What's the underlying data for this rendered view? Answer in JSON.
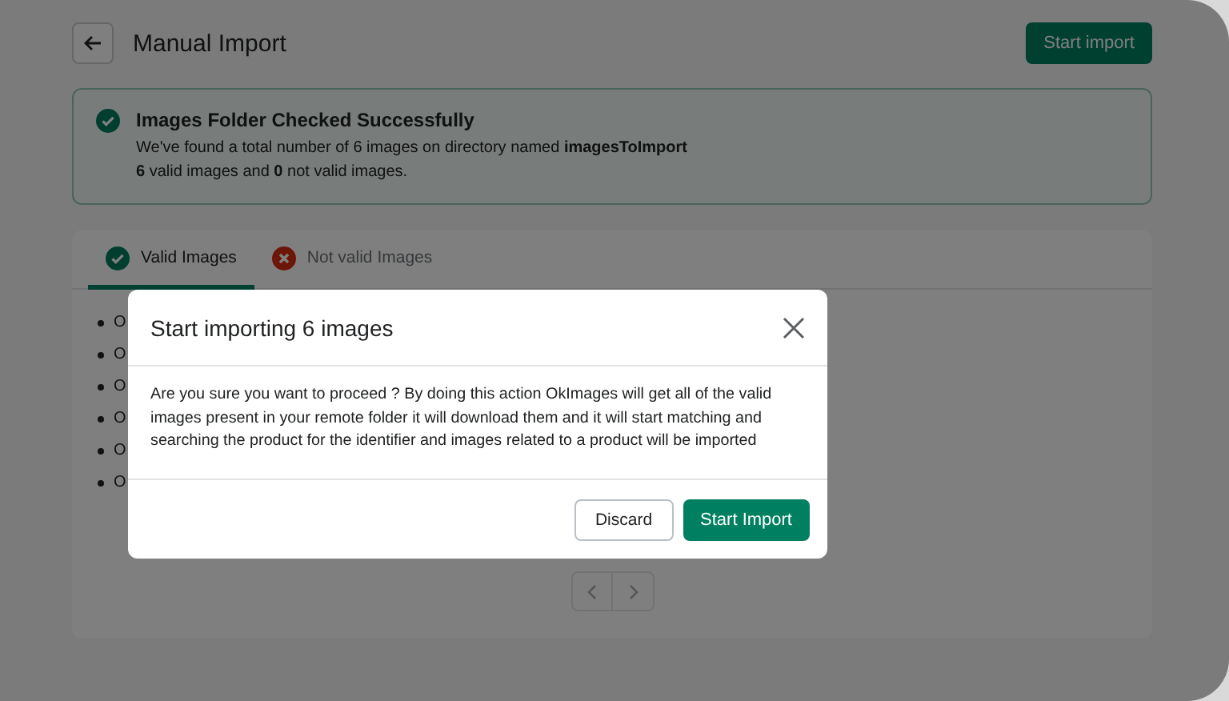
{
  "header": {
    "title": "Manual Import",
    "action": "Start import"
  },
  "banner": {
    "title": "Images Folder Checked Successfully",
    "lines": [
      "We've found a total number of 6 images on directory named **imagesToImport**",
      "**6** valid images and **0** not valid images."
    ]
  },
  "tabs": [
    {
      "label": "Valid Images",
      "kind": "valid",
      "selected": true
    },
    {
      "label": "Not valid Images",
      "kind": "invalid",
      "selected": false
    }
  ],
  "list_items": [
    "O",
    "O",
    "O",
    "O",
    "O",
    "O"
  ],
  "pagination": {
    "previous_disabled": true,
    "next_disabled": true
  },
  "modal": {
    "title": "Start importing 6 images",
    "body": "Are you sure you want to proceed ? By doing this action OkImages will get all of the valid images present in your remote folder it will download them and it will start matching and searching the product for the identifier and images related to a product will be imported",
    "buttons": [
      {
        "label": "Discard",
        "kind": "secondary"
      },
      {
        "label": "Start Import",
        "kind": "primary"
      }
    ]
  }
}
